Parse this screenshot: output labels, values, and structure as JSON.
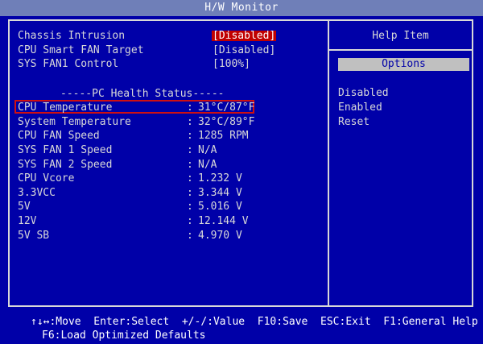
{
  "window": {
    "title": "H/W Monitor"
  },
  "settings": [
    {
      "label": "Chassis Intrusion",
      "value": "[Disabled]",
      "selected": true
    },
    {
      "label": "CPU Smart FAN Target",
      "value": "[Disabled]",
      "selected": false
    },
    {
      "label": "SYS FAN1 Control",
      "value": "[100%]",
      "selected": false
    }
  ],
  "health": {
    "title": "-----PC Health Status-----",
    "rows": [
      {
        "label": "CPU Temperature",
        "value": "31°C/87°F"
      },
      {
        "label": "System Temperature",
        "value": "32°C/89°F"
      },
      {
        "label": "CPU FAN Speed",
        "value": "1285 RPM"
      },
      {
        "label": "SYS FAN 1 Speed",
        "value": "N/A"
      },
      {
        "label": "SYS FAN 2 Speed",
        "value": "N/A"
      },
      {
        "label": "CPU Vcore",
        "value": "1.232 V"
      },
      {
        "label": "3.3VCC",
        "value": "3.344 V"
      },
      {
        "label": "5V",
        "value": "5.016 V"
      },
      {
        "label": "12V",
        "value": "12.144 V"
      },
      {
        "label": "5V SB",
        "value": "4.970 V"
      }
    ],
    "colon": ":"
  },
  "help": {
    "title": "Help Item",
    "options_label": "Options",
    "options": [
      "Disabled",
      "Enabled",
      "Reset"
    ]
  },
  "footer": {
    "line1": "↑↓↔:Move  Enter:Select  +/-/:Value  F10:Save  ESC:Exit  F1:General Help",
    "line2": "F6:Load Optimized Defaults"
  },
  "colors": {
    "background": "#0000a8",
    "text": "#d8d8d8",
    "selected_value_bg": "#c00000",
    "highlight_border": "#d01010",
    "options_bar": "#c0c0c0"
  }
}
